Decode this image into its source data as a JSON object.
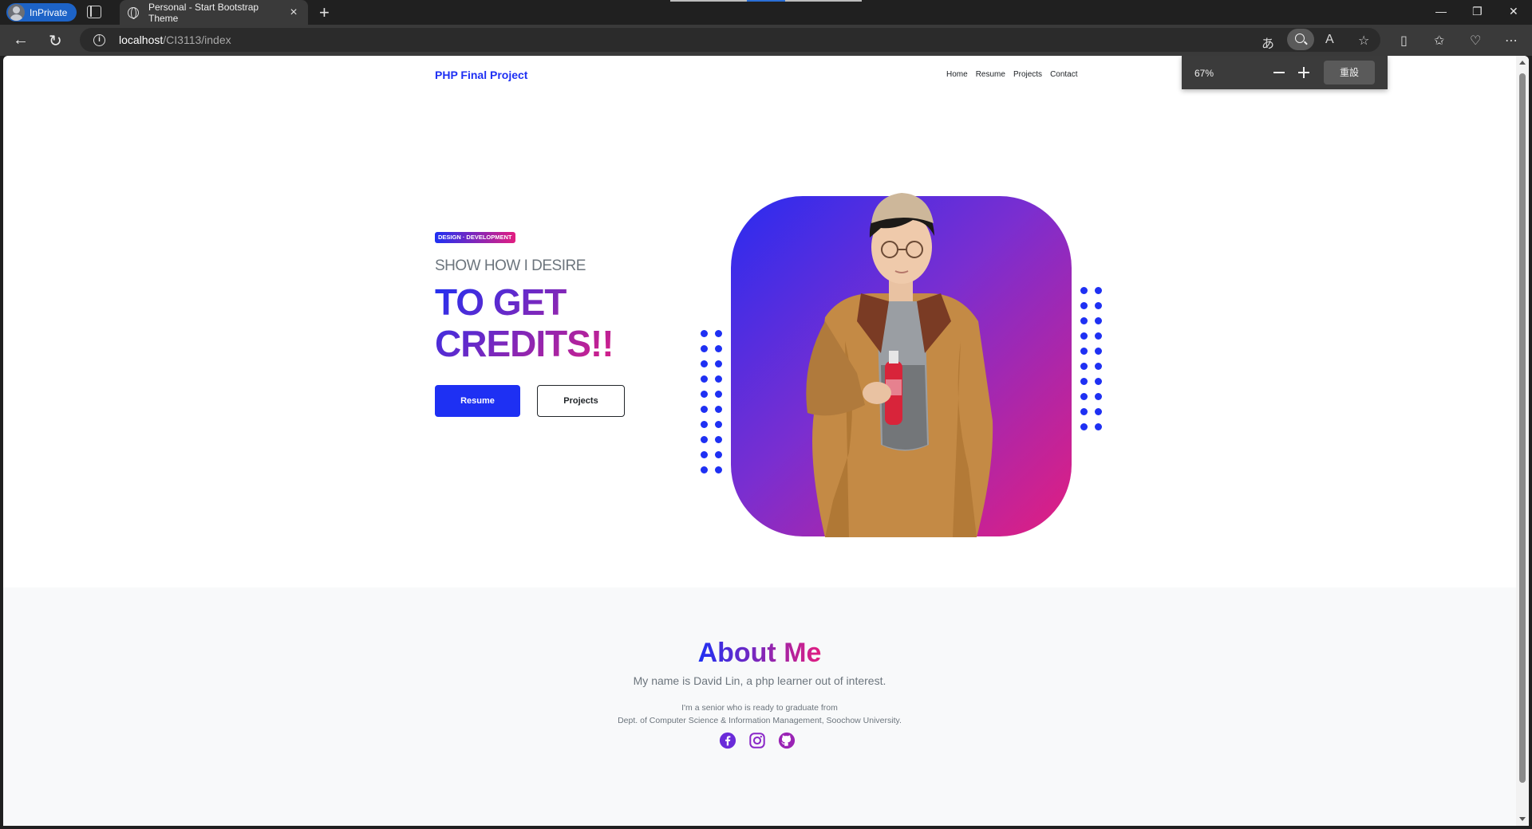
{
  "browser": {
    "inprivate_label": "InPrivate",
    "tab_title": "Personal - Start Bootstrap Theme",
    "url_host": "localhost",
    "url_path": "/CI3113/index",
    "zoom": {
      "percent": "67%",
      "reset_label": "重設"
    }
  },
  "site": {
    "brand": "PHP Final Project",
    "nav": [
      "Home",
      "Resume",
      "Projects",
      "Contact"
    ]
  },
  "hero": {
    "badge": "DESIGN · DEVELOPMENT",
    "subtitle": "SHOW HOW I DESIRE",
    "title_line1": "TO GET",
    "title_line2": "CREDITS!!",
    "primary_button": "Resume",
    "secondary_button": "Projects"
  },
  "about": {
    "title": "About Me",
    "lead": "My name is David Lin, a php learner out of interest.",
    "line1": "I'm a senior who is ready to graduate from",
    "line2": "Dept. of Computer Science & Information Management, Soochow University.",
    "socials": [
      "facebook-icon",
      "instagram-icon",
      "github-icon"
    ]
  },
  "colors": {
    "primary": "#1e30f3",
    "accent": "#e21e80",
    "chrome_dark": "#202020",
    "chrome_toolbar": "#3a3a3a"
  }
}
